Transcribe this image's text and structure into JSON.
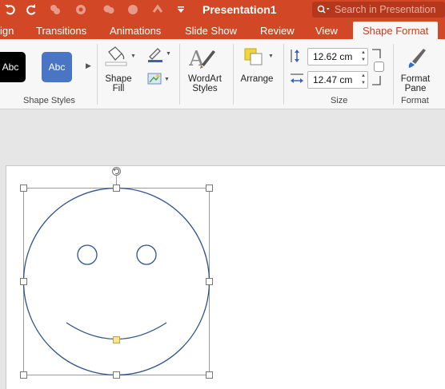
{
  "titlebar": {
    "title": "Presentation1",
    "search_placeholder": "Search in Presentation",
    "accent": "#d24726",
    "quick_access_icons": [
      "undo-icon",
      "redo-icon",
      "save-icon",
      "print-icon",
      "format-painter-icon",
      "customize-icon"
    ]
  },
  "tabs": [
    {
      "label": "ign"
    },
    {
      "label": "Transitions"
    },
    {
      "label": "Animations"
    },
    {
      "label": "Slide Show"
    },
    {
      "label": "Review"
    },
    {
      "label": "View"
    },
    {
      "label": "Shape Format",
      "active": true
    }
  ],
  "ribbon": {
    "shape_styles": {
      "swatches": [
        "Abc",
        "Abc"
      ],
      "label": "Shape Styles"
    },
    "shape_fill": {
      "label_line1": "Shape",
      "label_line2": "Fill"
    },
    "wordart": {
      "label_line1": "WordArt",
      "label_line2": "Styles"
    },
    "arrange": {
      "label": "Arrange"
    },
    "size": {
      "height": "12.62 cm",
      "width": "12.47 cm",
      "label": "Size"
    },
    "format": {
      "label_line1": "Format",
      "label_line2": "Pane",
      "group_label": "Format"
    }
  }
}
